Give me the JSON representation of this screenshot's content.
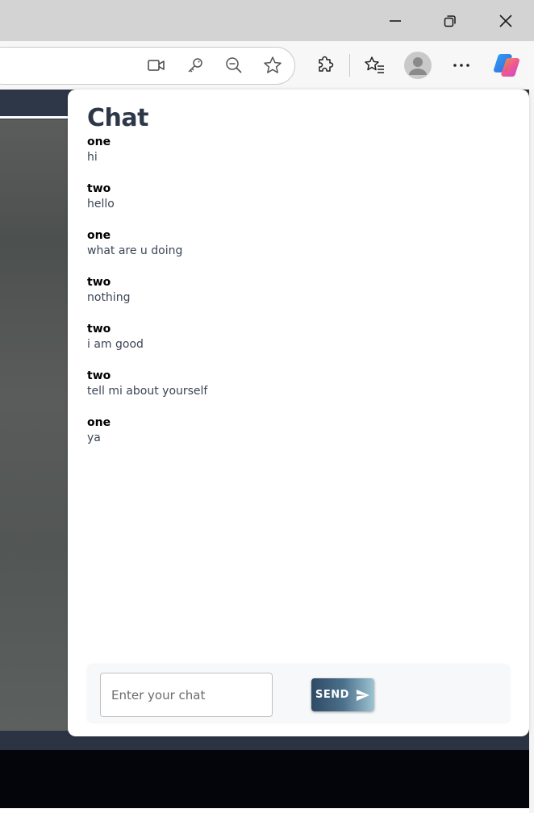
{
  "window_controls": {
    "minimize_icon": "minimize-icon",
    "restore_icon": "restore-icon",
    "close_icon": "close-icon"
  },
  "toolbar": {
    "address_icons": [
      "camera-icon",
      "key-icon",
      "zoom-out-icon",
      "favorite-star-icon"
    ],
    "right_icons": [
      "extensions-icon",
      "favorites-icon",
      "profile-avatar",
      "more-icon",
      "copilot-icon"
    ]
  },
  "chat": {
    "title": "Chat",
    "messages": [
      {
        "user": "one",
        "text": "hi"
      },
      {
        "user": "two",
        "text": "hello"
      },
      {
        "user": "one",
        "text": "what are u doing"
      },
      {
        "user": "two",
        "text": "nothing"
      },
      {
        "user": "two",
        "text": "i am good"
      },
      {
        "user": "two",
        "text": "tell mi about yourself"
      },
      {
        "user": "one",
        "text": "ya"
      }
    ],
    "input_placeholder": "Enter your chat",
    "input_value": "",
    "send_label": "SEND"
  },
  "colors": {
    "title": "#2d3748",
    "message_text": "#3b4557",
    "send_gradient_start": "#2f4a64",
    "send_gradient_end": "#9ec3d1"
  }
}
